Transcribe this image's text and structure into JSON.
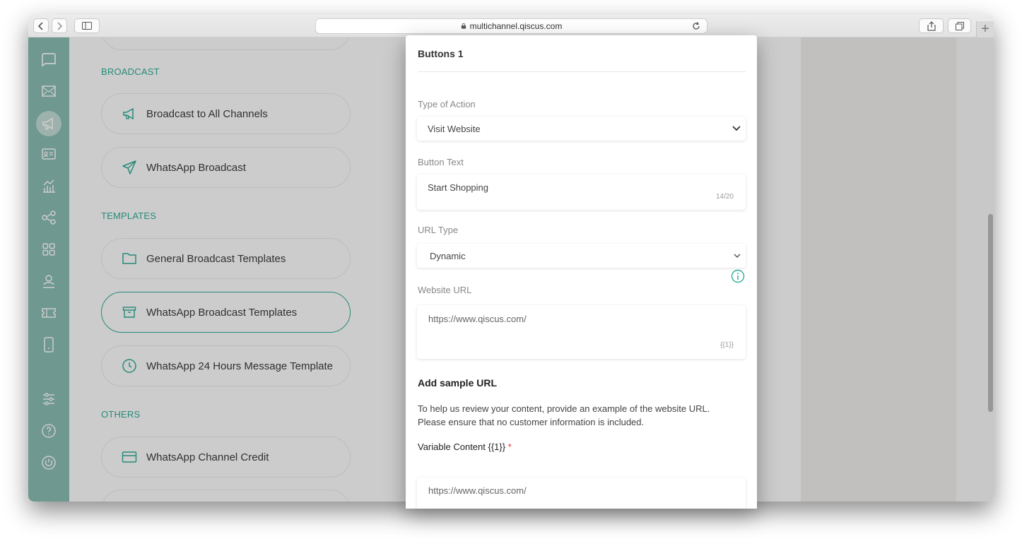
{
  "browser": {
    "url": "multichannel.qiscus.com"
  },
  "sidebar": {
    "sections": [
      {
        "label": "BROADCAST"
      },
      {
        "label": "TEMPLATES"
      },
      {
        "label": "OTHERS"
      }
    ],
    "items": [
      {
        "label": "Broadcast to All Channels",
        "icon": "megaphone-icon"
      },
      {
        "label": "WhatsApp Broadcast",
        "icon": "send-icon"
      },
      {
        "label": "General Broadcast Templates",
        "icon": "folder-icon"
      },
      {
        "label": "WhatsApp Broadcast Templates",
        "icon": "archive-icon",
        "active": true
      },
      {
        "label": "WhatsApp 24 Hours Message Template",
        "icon": "clock-icon"
      },
      {
        "label": "WhatsApp Channel Credit",
        "icon": "credit-card-icon"
      }
    ]
  },
  "modal": {
    "title": "Buttons 1",
    "type_of_action": {
      "label": "Type of Action",
      "value": "Visit Website"
    },
    "button_text": {
      "label": "Button Text",
      "value": "Start Shopping",
      "counter": "14/20"
    },
    "url_type": {
      "label": "URL Type",
      "value": "Dynamic"
    },
    "website_url": {
      "label": "Website URL",
      "value": "https://www.qiscus.com/",
      "variable_tag": "{{1}}"
    },
    "sample": {
      "heading": "Add sample URL",
      "description_line1": "To help us review your content, provide an example of the website URL.",
      "description_line2": "Please ensure that no customer information is included.",
      "variable_label": "Variable Content {{1}}",
      "required_mark": "*",
      "variable_value": "https://www.qiscus.com/"
    }
  },
  "colors": {
    "accent": "#2fae97",
    "nav_rail": "#8bbfb5",
    "required": "#e53935"
  }
}
